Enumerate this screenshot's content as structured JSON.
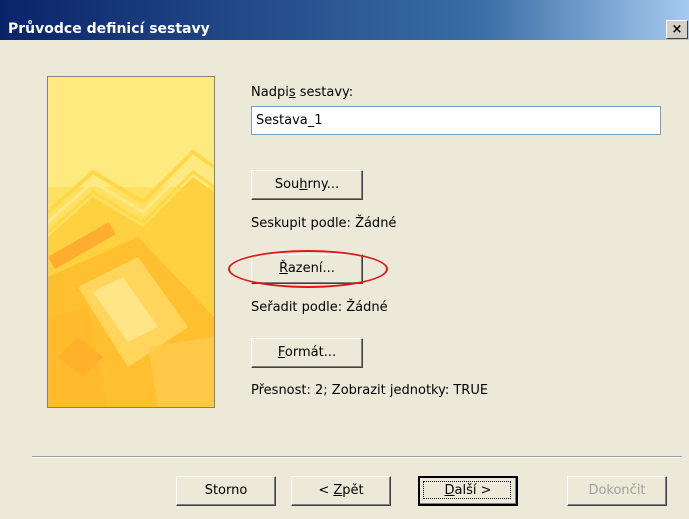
{
  "window": {
    "title": "Průvodce definicí sestavy",
    "close_glyph": "×"
  },
  "form": {
    "title_label_pre": "Nadpi",
    "title_label_key": "s",
    "title_label_post": " sestavy:",
    "title_value": "Sestava_1",
    "summaries": {
      "pre": "Sou",
      "key": "h",
      "post": "rny...",
      "status": "Seskupit podle: Žádné"
    },
    "sorting": {
      "pre": "",
      "key": "Ř",
      "post": "azení...",
      "status": "Seřadit podle: Žádné"
    },
    "format": {
      "pre": "",
      "key": "F",
      "post": "ormát...",
      "status": "Přesnost: 2;  Zobrazit jednotky: TRUE"
    }
  },
  "footer": {
    "cancel": "Storno",
    "back_pre": "< ",
    "back_key": "Z",
    "back_post": "pět",
    "next_pre": "",
    "next_key": "D",
    "next_post": "alší >",
    "finish": "Dokončit"
  },
  "colors": {
    "highlight": "#e01818",
    "banner": "#ffe060"
  },
  "icons": {
    "close": "close-icon",
    "banner": "wizard-banner-graphic"
  }
}
